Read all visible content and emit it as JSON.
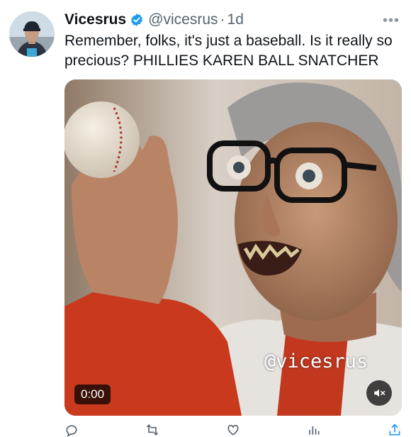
{
  "tweet": {
    "display_name": "Vicesrus",
    "handle": "@vicesrus",
    "separator": "·",
    "time": "1d",
    "more_glyph": "•••",
    "text": "Remember, folks, it's just a baseball. Is it really so precious? PHILLIES KAREN BALL SNATCHER",
    "media": {
      "watermark": "@vicesrus",
      "video_time": "0:00",
      "muted": true
    }
  },
  "colors": {
    "verified": "#1d9bf0",
    "muted_text": "#536471"
  },
  "icons": [
    "verified-badge-icon",
    "more-icon",
    "mute-icon",
    "reply-icon",
    "repost-icon",
    "like-icon",
    "views-icon",
    "share-icon"
  ]
}
